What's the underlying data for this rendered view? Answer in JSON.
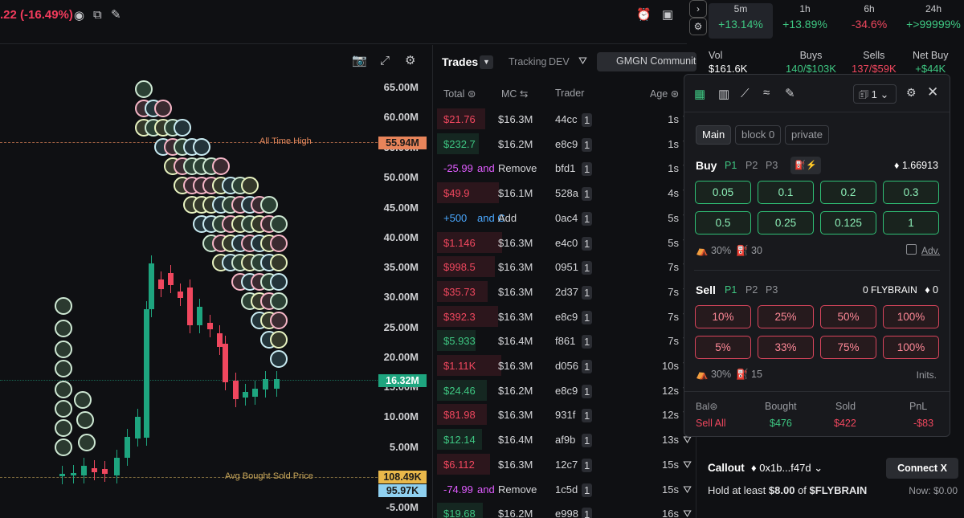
{
  "header": {
    "change_pct": ".22 (-16.49%)"
  },
  "chart": {
    "y_labels": [
      "65.00M",
      "60.00M",
      "55.00M",
      "50.00M",
      "45.00M",
      "40.00M",
      "35.00M",
      "30.00M",
      "25.00M",
      "20.00M",
      "15.00M",
      "10.00M",
      "5.00M",
      "-5.00M"
    ],
    "ath_text": "All Time High",
    "ath_value": "55.94M",
    "current_value": "16.32M",
    "avg_text": "Avg Bought Sold Price",
    "avg_value": "108.49K",
    "avg_value2": "95.97K",
    "colors": {
      "up": "#1ea57f",
      "down": "#f0475e"
    }
  },
  "trades": {
    "title": "Trades",
    "tracking": "Tracking",
    "dev": "DEV",
    "community": "GMGN Communit",
    "columns": {
      "total": "Total",
      "mc": "MC",
      "trader": "Trader",
      "age": "Age"
    },
    "rows": [
      {
        "total": "$21.76",
        "type": "sell",
        "mc": "$16.3M",
        "trader": "44cc",
        "badge": "1",
        "age": "1s"
      },
      {
        "total": "$232.7",
        "type": "buy",
        "mc": "$16.2M",
        "trader": "e8c9",
        "badge": "1",
        "age": "1s"
      },
      {
        "total": "-25.99",
        "extra": "and",
        "type": "rem",
        "mc": "Remove",
        "trader": "bfd1",
        "badge": "1",
        "age": "1s"
      },
      {
        "total": "$49.9",
        "type": "sell",
        "mc": "$16.1M",
        "trader": "528a",
        "badge": "1",
        "age": "4s"
      },
      {
        "total": "+500",
        "extra": "and C",
        "type": "addl",
        "mc": "Add",
        "trader": "0ac4",
        "badge": "1",
        "age": "5s"
      },
      {
        "total": "$1.146",
        "type": "sell",
        "mc": "$16.3M",
        "trader": "e4c0",
        "badge": "1",
        "age": "5s"
      },
      {
        "total": "$998.5",
        "type": "sell",
        "mc": "$16.3M",
        "trader": "0951",
        "badge": "1",
        "age": "7s"
      },
      {
        "total": "$35.73",
        "type": "sell",
        "mc": "$16.3M",
        "trader": "2d37",
        "badge": "1",
        "age": "7s"
      },
      {
        "total": "$392.3",
        "type": "sell",
        "mc": "$16.3M",
        "trader": "e8c9",
        "badge": "1",
        "age": "7s"
      },
      {
        "total": "$5.933",
        "type": "buy",
        "mc": "$16.4M",
        "trader": "f861",
        "badge": "1",
        "age": "7s"
      },
      {
        "total": "$1.11K",
        "type": "sell",
        "mc": "$16.3M",
        "trader": "d056",
        "badge": "1",
        "age": "10s"
      },
      {
        "total": "$24.46",
        "type": "buy",
        "mc": "$16.2M",
        "trader": "e8c9",
        "badge": "1",
        "age": "12s"
      },
      {
        "total": "$81.98",
        "type": "sell",
        "mc": "$16.3M",
        "trader": "931f",
        "badge": "1",
        "age": "12s"
      },
      {
        "total": "$12.14",
        "type": "buy",
        "mc": "$16.4M",
        "trader": "af9b",
        "badge": "1",
        "age": "13s"
      },
      {
        "total": "$6.112",
        "type": "sell",
        "mc": "$16.3M",
        "trader": "12c7",
        "badge": "1",
        "age": "15s"
      },
      {
        "total": "-74.99",
        "extra": "and",
        "type": "rem",
        "mc": "Remove",
        "trader": "1c5d",
        "badge": "1",
        "age": "15s"
      },
      {
        "total": "$19.68",
        "type": "buy",
        "mc": "$16.2M",
        "trader": "e998",
        "badge": "1",
        "age": "16s"
      }
    ]
  },
  "stats": {
    "timeframes": [
      {
        "l": "5m",
        "v": "+13.14%",
        "c": "up"
      },
      {
        "l": "1h",
        "v": "+13.89%",
        "c": "up"
      },
      {
        "l": "6h",
        "v": "-34.6%",
        "c": "down"
      },
      {
        "l": "24h",
        "v": "+>99999%",
        "c": "up"
      }
    ],
    "vol": {
      "l": "Vol",
      "v": "$161.6K"
    },
    "buys": {
      "l": "Buys",
      "v1": "140",
      "v2": "$103K"
    },
    "sells": {
      "l": "Sells",
      "v1": "137",
      "v2": "$59K"
    },
    "net": {
      "l": "Net Buy",
      "v": "+$44K"
    }
  },
  "trade_panel": {
    "preset": "1",
    "tabs": [
      "Main",
      "block 0",
      "private"
    ],
    "buy": {
      "label": "Buy",
      "presets": [
        "P1",
        "P2",
        "P3"
      ],
      "balance": "1.66913",
      "amounts": [
        "0.05",
        "0.1",
        "0.2",
        "0.3",
        "0.5",
        "0.25",
        "0.125",
        "1"
      ],
      "slippage": "30%",
      "gas": "30",
      "adv": "Adv."
    },
    "sell": {
      "label": "Sell",
      "presets": [
        "P1",
        "P2",
        "P3"
      ],
      "balance_token": "0 FLYBRAIN",
      "balance_eth": "0",
      "amounts": [
        "10%",
        "25%",
        "50%",
        "100%",
        "5%",
        "33%",
        "75%",
        "100%"
      ],
      "slippage": "30%",
      "gas": "15",
      "inits": "Inits."
    },
    "footer": {
      "bal": "Bal",
      "sell_all": "Sell All",
      "bought_l": "Bought",
      "bought_v": "$476",
      "sold_l": "Sold",
      "sold_v": "$422",
      "pnl_l": "PnL",
      "pnl_v": "-$83"
    }
  },
  "callout": {
    "title": "Callout",
    "addr": "0x1b...f47d",
    "connect": "Connect X",
    "hold_pre": "Hold at least",
    "hold_amt": "$8.00",
    "hold_of": "of",
    "hold_tok": "$FLYBRAIN",
    "now": "Now: $0.00"
  }
}
